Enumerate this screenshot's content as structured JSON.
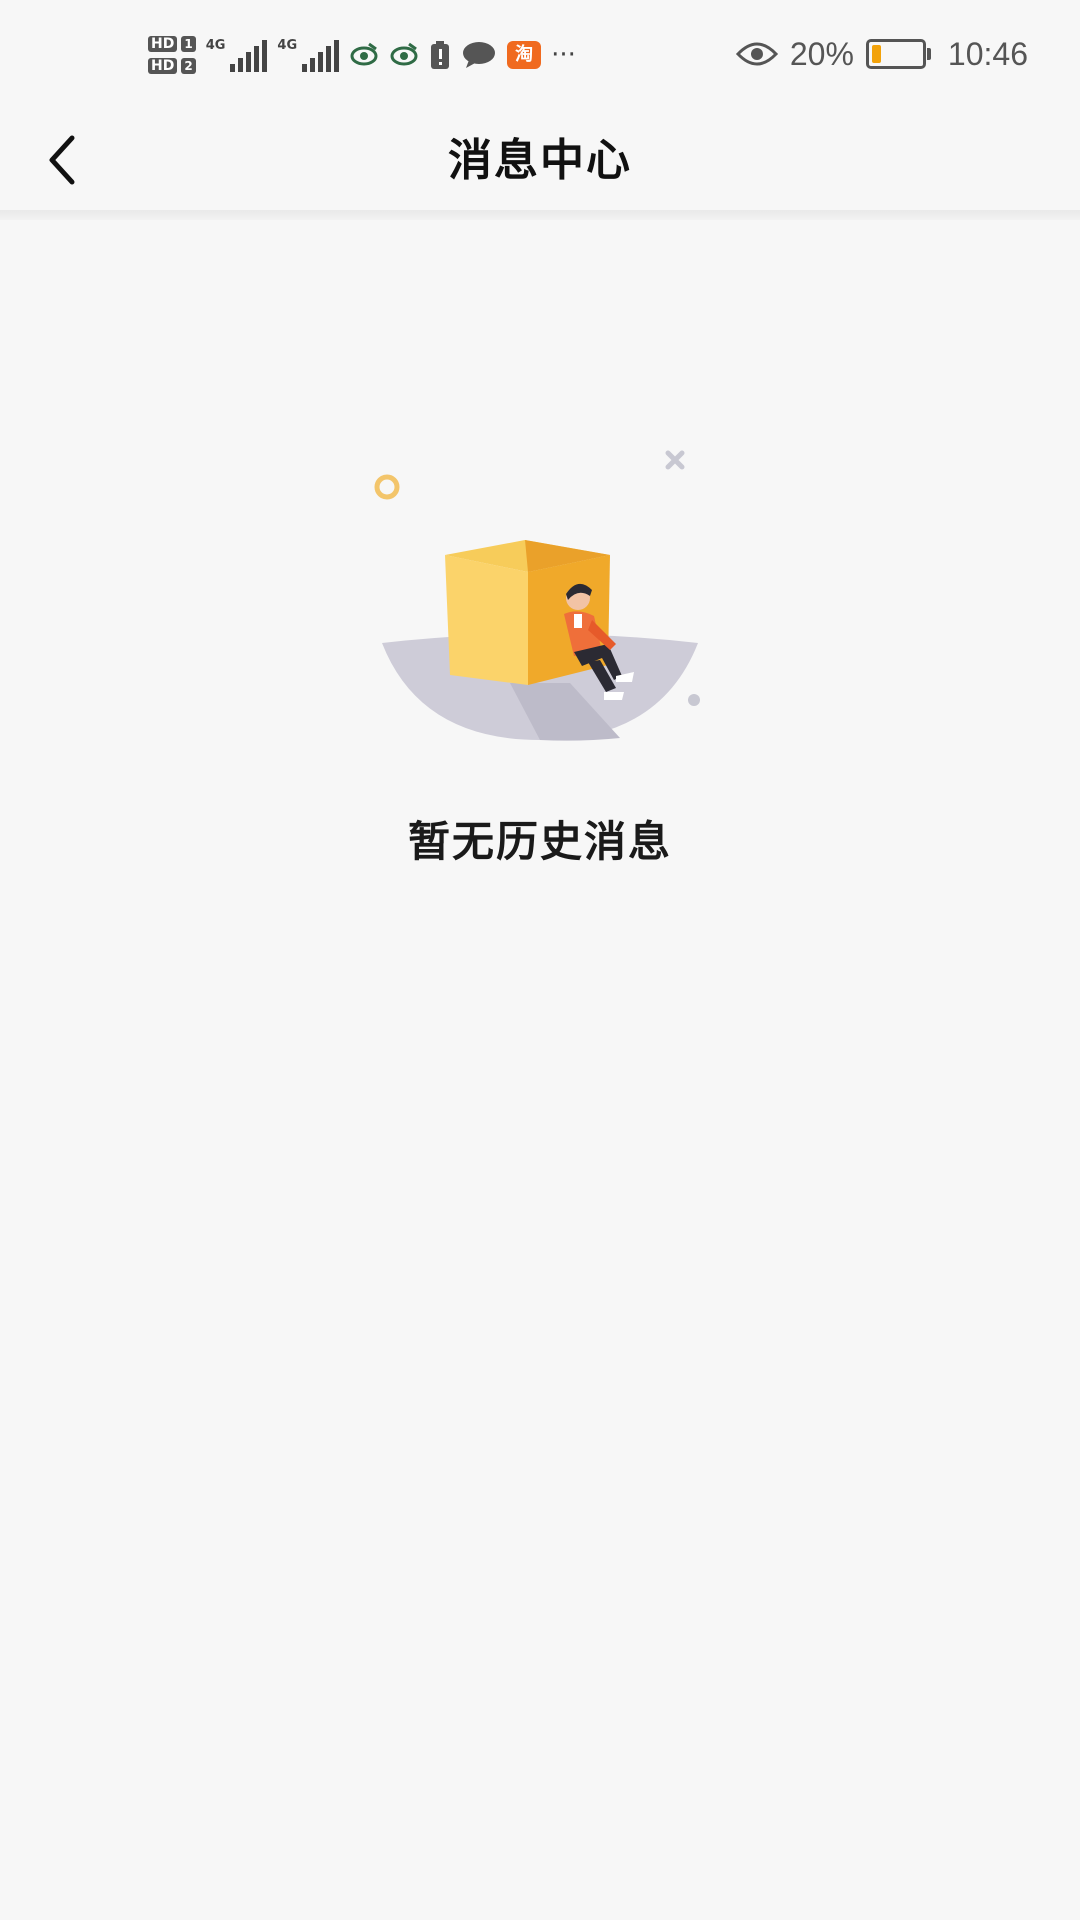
{
  "status_bar": {
    "hd1": "HD",
    "sim1": "1",
    "hd2": "HD",
    "sim2": "2",
    "net1": "4G",
    "net2": "4G",
    "battery_percent": "20%",
    "time": "10:46",
    "more": "···",
    "icons": [
      "eye-icon",
      "eye-icon",
      "battery-warning-icon",
      "chat-icon",
      "taobao-icon"
    ]
  },
  "header": {
    "title": "消息中心",
    "back_icon": "chevron-left-icon"
  },
  "empty_state": {
    "message": "暂无历史消息",
    "illustration": "empty-box-illustration"
  },
  "colors": {
    "background": "#f7f7f7",
    "box_yellow": "#f6b62b",
    "accent_orange": "#ef6f3a",
    "battery_level": "#f2a20a"
  }
}
